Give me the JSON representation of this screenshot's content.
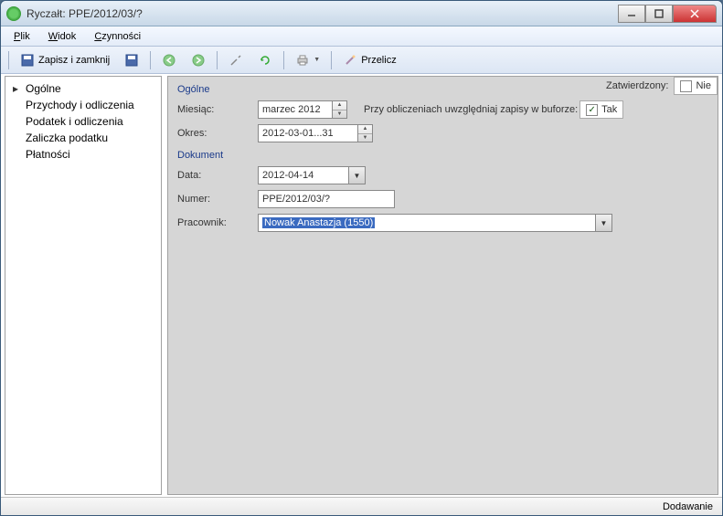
{
  "window": {
    "title": "Ryczałt: PPE/2012/03/?"
  },
  "menu": {
    "plik": "Plik",
    "widok": "Widok",
    "czynnosci": "Czynności"
  },
  "toolbar": {
    "zapisz": "Zapisz i zamknij",
    "przelicz": "Przelicz"
  },
  "sidebar": {
    "items": [
      "Ogólne",
      "Przychody i odliczenia",
      "Podatek i odliczenia",
      "Zaliczka podatku",
      "Płatności"
    ]
  },
  "section_ogolne": {
    "label": "Ogólne",
    "miesiac_label": "Miesiąc:",
    "miesiac_value": "marzec 2012",
    "okres_label": "Okres:",
    "okres_value": "2012-03-01...31",
    "buffor_label": "Przy obliczeniach uwzględniaj zapisy w buforze:",
    "tak": "Tak",
    "zatwierdzony_label": "Zatwierdzony:",
    "nie": "Nie"
  },
  "section_dokument": {
    "label": "Dokument",
    "data_label": "Data:",
    "data_value": "2012-04-14",
    "numer_label": "Numer:",
    "numer_value": "PPE/2012/03/?",
    "pracownik_label": "Pracownik:",
    "pracownik_value": "Nowak Anastazja (1550)"
  },
  "status": {
    "text": "Dodawanie"
  }
}
